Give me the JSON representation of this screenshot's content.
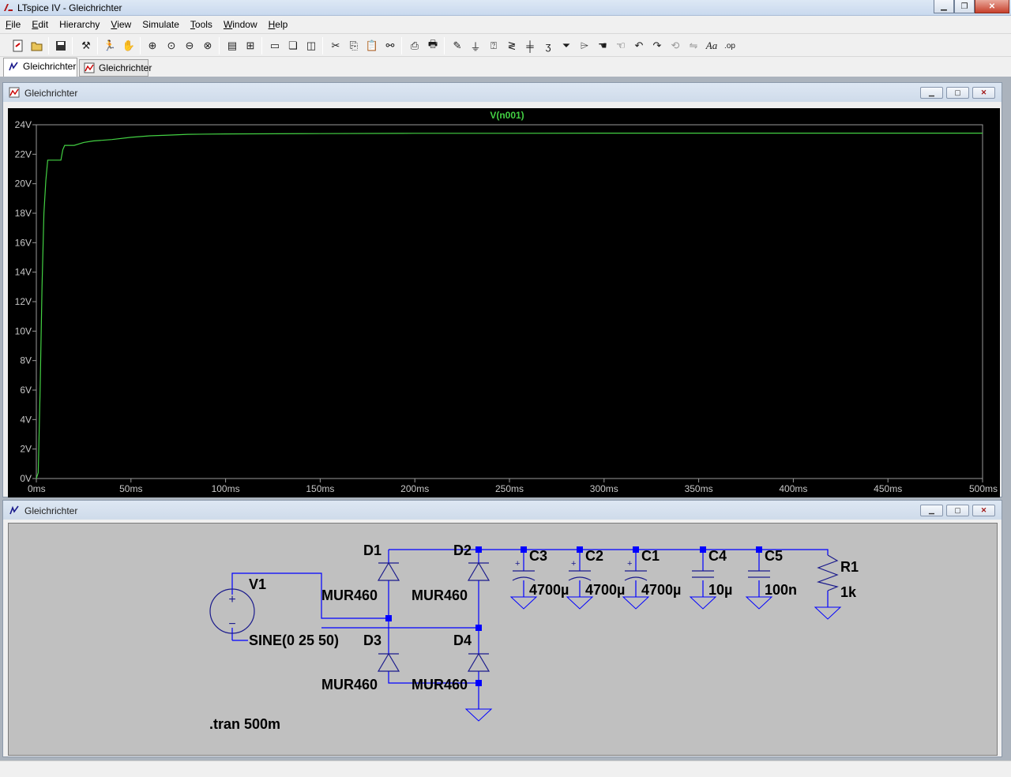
{
  "window": {
    "title": "LTspice IV - Gleichrichter"
  },
  "menu": {
    "items": [
      "File",
      "Edit",
      "Hierarchy",
      "View",
      "Simulate",
      "Tools",
      "Window",
      "Help"
    ]
  },
  "tabs": [
    {
      "label": "Gleichrichter",
      "kind": "schematic",
      "active": true
    },
    {
      "label": "Gleichrichter",
      "kind": "waveform",
      "active": false
    }
  ],
  "waveform_window": {
    "title": "Gleichrichter"
  },
  "schematic_window": {
    "title": "Gleichrichter"
  },
  "colors": {
    "trace": "#43d143",
    "plot_bg": "#000000",
    "axis_text": "#c8c8c8",
    "wire": "#0000ff",
    "component": "#1a1a8c",
    "schematic_bg": "#c0c0c0"
  },
  "chart_data": {
    "type": "line",
    "series": [
      {
        "name": "V(n001)",
        "x": [
          0,
          1,
          2,
          3,
          4,
          5,
          6,
          8,
          10,
          13,
          14,
          15,
          20,
          25,
          30,
          40,
          50,
          60,
          70,
          80,
          100,
          150,
          200,
          250,
          300,
          350,
          400,
          450,
          500
        ],
        "y": [
          0,
          0.4,
          6.0,
          13.0,
          18.0,
          20.2,
          21.6,
          21.6,
          21.6,
          21.6,
          22.3,
          22.6,
          22.6,
          22.8,
          22.9,
          23.0,
          23.15,
          23.25,
          23.3,
          23.35,
          23.38,
          23.4,
          23.42,
          23.42,
          23.43,
          23.43,
          23.43,
          23.43,
          23.43
        ]
      }
    ],
    "xlim": [
      0,
      500
    ],
    "ylim": [
      0,
      24
    ],
    "x_ticks": [
      "0ms",
      "50ms",
      "100ms",
      "150ms",
      "200ms",
      "250ms",
      "300ms",
      "350ms",
      "400ms",
      "450ms",
      "500ms"
    ],
    "y_ticks": [
      "0V",
      "2V",
      "4V",
      "6V",
      "8V",
      "10V",
      "12V",
      "14V",
      "16V",
      "18V",
      "20V",
      "22V",
      "24V"
    ],
    "grid": false
  },
  "schematic": {
    "source": {
      "ref": "V1",
      "value": "SINE(0 25 50)"
    },
    "diodes": [
      {
        "ref": "D1",
        "model": "MUR460"
      },
      {
        "ref": "D2",
        "model": "MUR460"
      },
      {
        "ref": "D3",
        "model": "MUR460"
      },
      {
        "ref": "D4",
        "model": "MUR460"
      }
    ],
    "capacitors": [
      {
        "ref": "C3",
        "value": "4700µ"
      },
      {
        "ref": "C2",
        "value": "4700µ"
      },
      {
        "ref": "C1",
        "value": "4700µ"
      },
      {
        "ref": "C4",
        "value": "10µ"
      },
      {
        "ref": "C5",
        "value": "100n"
      }
    ],
    "resistor": {
      "ref": "R1",
      "value": "1k"
    },
    "directive": ".tran 500m"
  }
}
